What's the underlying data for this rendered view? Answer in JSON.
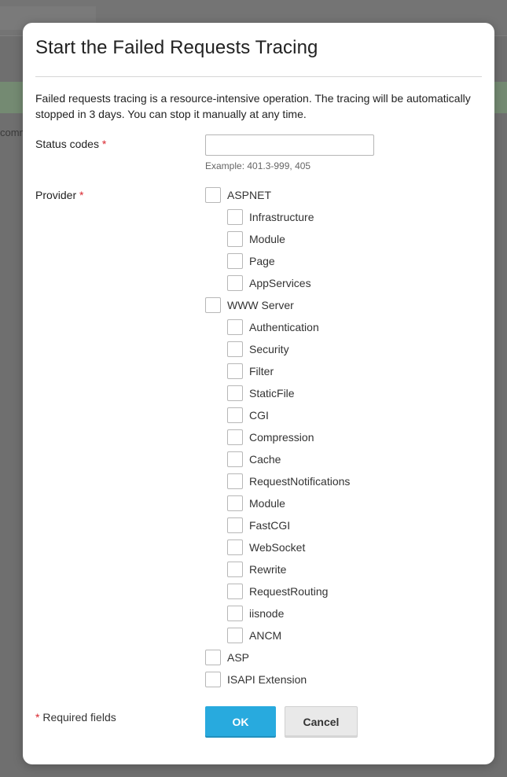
{
  "background": {
    "partial_text": "comm"
  },
  "dialog": {
    "title": "Start the Failed Requests Tracing",
    "intro": "Failed requests tracing is a resource-intensive operation. The tracing will be automatically stopped in 3 days. You can stop it manually at any time.",
    "status_codes": {
      "label": "Status codes",
      "required_mark": "*",
      "value": "",
      "hint": "Example: 401.3-999, 405"
    },
    "provider": {
      "label": "Provider",
      "required_mark": "*",
      "options": [
        {
          "label": "ASPNET",
          "level": 0,
          "checked": false
        },
        {
          "label": "Infrastructure",
          "level": 1,
          "checked": false
        },
        {
          "label": "Module",
          "level": 1,
          "checked": false
        },
        {
          "label": "Page",
          "level": 1,
          "checked": false
        },
        {
          "label": "AppServices",
          "level": 1,
          "checked": false
        },
        {
          "label": "WWW Server",
          "level": 0,
          "checked": false
        },
        {
          "label": "Authentication",
          "level": 1,
          "checked": false
        },
        {
          "label": "Security",
          "level": 1,
          "checked": false
        },
        {
          "label": "Filter",
          "level": 1,
          "checked": false
        },
        {
          "label": "StaticFile",
          "level": 1,
          "checked": false
        },
        {
          "label": "CGI",
          "level": 1,
          "checked": false
        },
        {
          "label": "Compression",
          "level": 1,
          "checked": false
        },
        {
          "label": "Cache",
          "level": 1,
          "checked": false
        },
        {
          "label": "RequestNotifications",
          "level": 1,
          "checked": false
        },
        {
          "label": "Module",
          "level": 1,
          "checked": false
        },
        {
          "label": "FastCGI",
          "level": 1,
          "checked": false
        },
        {
          "label": "WebSocket",
          "level": 1,
          "checked": false
        },
        {
          "label": "Rewrite",
          "level": 1,
          "checked": false
        },
        {
          "label": "RequestRouting",
          "level": 1,
          "checked": false
        },
        {
          "label": "iisnode",
          "level": 1,
          "checked": false
        },
        {
          "label": "ANCM",
          "level": 1,
          "checked": false
        },
        {
          "label": "ASP",
          "level": 0,
          "checked": false
        },
        {
          "label": "ISAPI Extension",
          "level": 0,
          "checked": false
        }
      ]
    },
    "required_note": {
      "mark": "*",
      "text": " Required fields"
    },
    "buttons": {
      "ok": "OK",
      "cancel": "Cancel"
    },
    "colors": {
      "primary_button": "#28aade",
      "required_mark": "#d9262e"
    }
  }
}
